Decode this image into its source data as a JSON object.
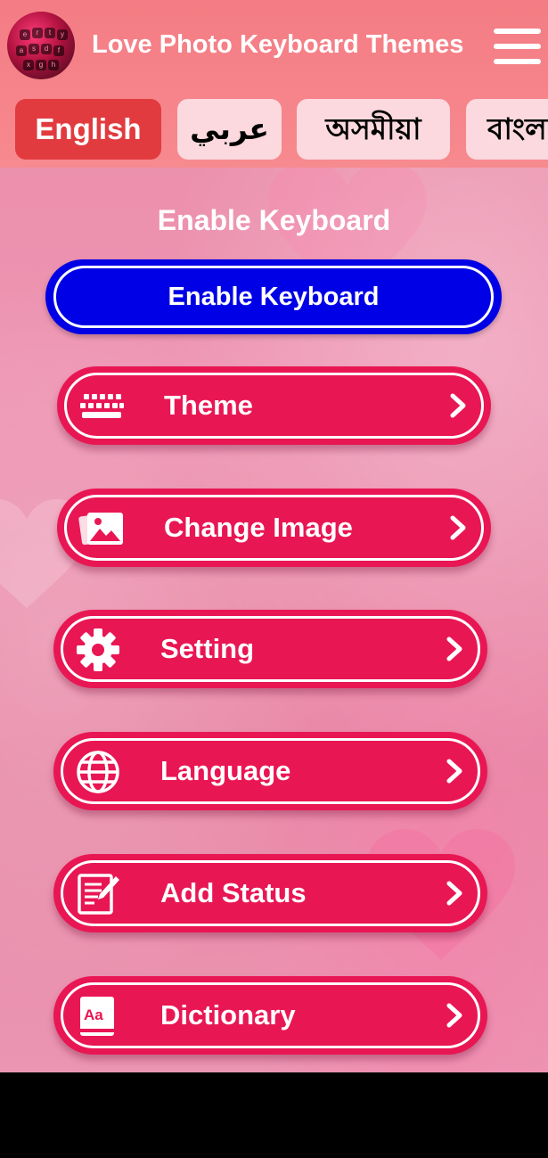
{
  "app": {
    "title": "Love Photo Keyboard Themes"
  },
  "language_tabs": [
    {
      "label": "English",
      "active": true
    },
    {
      "label": "عربي",
      "active": false
    },
    {
      "label": "অসমীয়া",
      "active": false
    },
    {
      "label": "বাংলা",
      "active": false
    }
  ],
  "section": {
    "title": "Enable Keyboard"
  },
  "enable_button": {
    "label": "Enable Keyboard"
  },
  "menu": [
    {
      "label": "Theme",
      "icon": "keyboard-icon"
    },
    {
      "label": "Change Image",
      "icon": "image-icon"
    },
    {
      "label": "Setting",
      "icon": "gear-icon"
    },
    {
      "label": "Language",
      "icon": "globe-icon"
    },
    {
      "label": "Add Status",
      "icon": "edit-note-icon"
    },
    {
      "label": "Dictionary",
      "icon": "dictionary-icon"
    }
  ],
  "colors": {
    "header": "#f47c84",
    "active_tab": "#e23b3f",
    "enable_button": "#0000e6",
    "menu_button": "#e91654"
  }
}
